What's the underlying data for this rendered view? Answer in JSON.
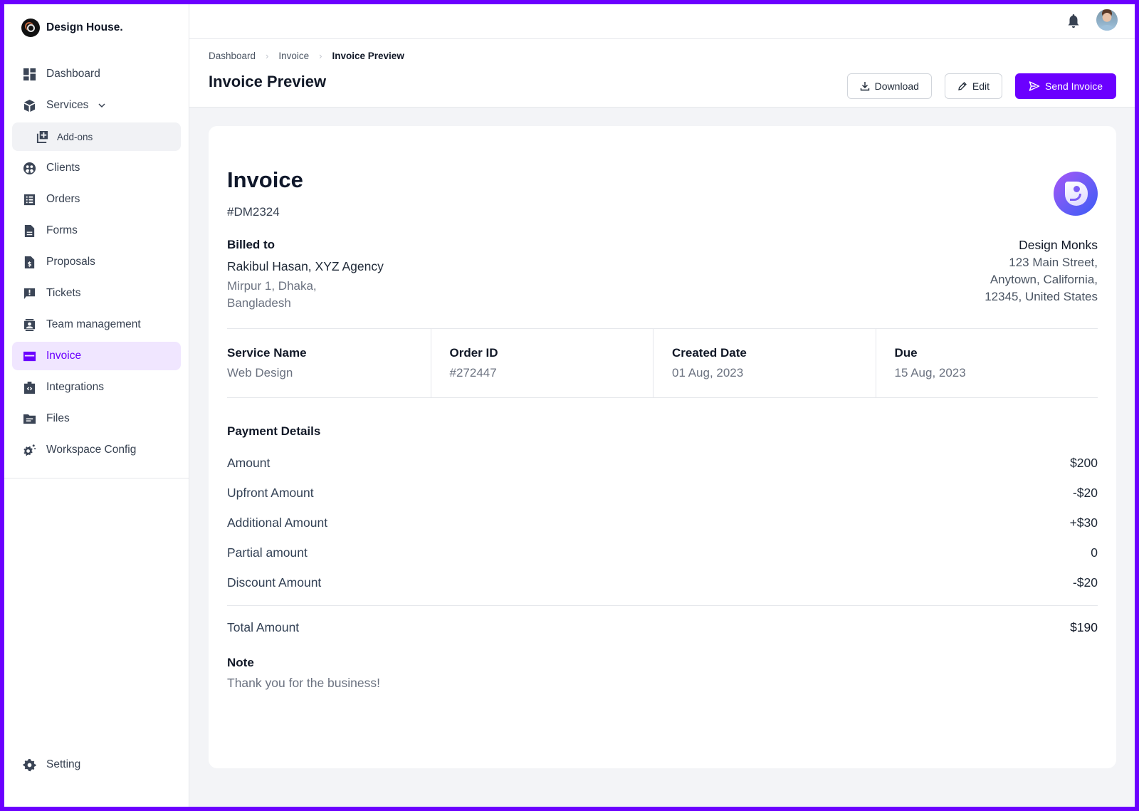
{
  "brand": {
    "name": "Design House."
  },
  "sidebar": {
    "items": [
      {
        "label": "Dashboard",
        "icon": "dashboard-icon"
      },
      {
        "label": "Services",
        "icon": "box-icon",
        "expanded": true
      },
      {
        "label": "Add-ons",
        "icon": "add-library-icon",
        "sub": true
      },
      {
        "label": "Clients",
        "icon": "clients-icon"
      },
      {
        "label": "Orders",
        "icon": "list-icon"
      },
      {
        "label": "Forms",
        "icon": "document-icon"
      },
      {
        "label": "Proposals",
        "icon": "dollar-document-icon"
      },
      {
        "label": "Tickets",
        "icon": "alert-message-icon"
      },
      {
        "label": "Team management",
        "icon": "contact-card-icon"
      },
      {
        "label": "Invoice",
        "icon": "credit-card-icon",
        "active": true
      },
      {
        "label": "Integrations",
        "icon": "code-badge-icon"
      },
      {
        "label": "Files",
        "icon": "folder-icon"
      },
      {
        "label": "Workspace Config",
        "icon": "gears-icon"
      }
    ],
    "bottom": {
      "label": "Setting",
      "icon": "gear-icon"
    }
  },
  "topbar": {
    "notifications_icon": "bell-icon",
    "avatar_icon": "user-avatar"
  },
  "header": {
    "breadcrumb": [
      "Dashboard",
      "Invoice",
      "Invoice Preview"
    ],
    "title": "Invoice Preview",
    "actions": {
      "download": "Download",
      "edit": "Edit",
      "send": "Send Invoice"
    },
    "accent_color": "#6B00FF"
  },
  "invoice": {
    "title": "Invoice",
    "number": "#DM2324",
    "billed_to": {
      "label": "Billed to",
      "name": "Rakibul Hasan, XYZ Agency",
      "address_line1": "Mirpur 1, Dhaka,",
      "address_line2": "Bangladesh"
    },
    "seller": {
      "name": "Design Monks",
      "address_line1": "123 Main Street,",
      "address_line2": "Anytown, California,",
      "address_line3": "12345, United States"
    },
    "meta": [
      {
        "label": "Service Name",
        "value": "Web Design"
      },
      {
        "label": "Order ID",
        "value": "#272447"
      },
      {
        "label": "Created Date",
        "value": "01 Aug, 2023"
      },
      {
        "label": "Due",
        "value": "15 Aug, 2023"
      }
    ],
    "payment": {
      "title": "Payment Details",
      "rows": [
        {
          "label": "Amount",
          "value": "$200"
        },
        {
          "label": "Upfront Amount",
          "value": "-$20"
        },
        {
          "label": "Additional Amount",
          "value": "+$30"
        },
        {
          "label": "Partial amount",
          "value": "0"
        },
        {
          "label": "Discount Amount",
          "value": "-$20"
        }
      ],
      "total": {
        "label": "Total Amount",
        "value": "$190"
      }
    },
    "note": {
      "label": "Note",
      "text": "Thank you for the business!"
    }
  }
}
